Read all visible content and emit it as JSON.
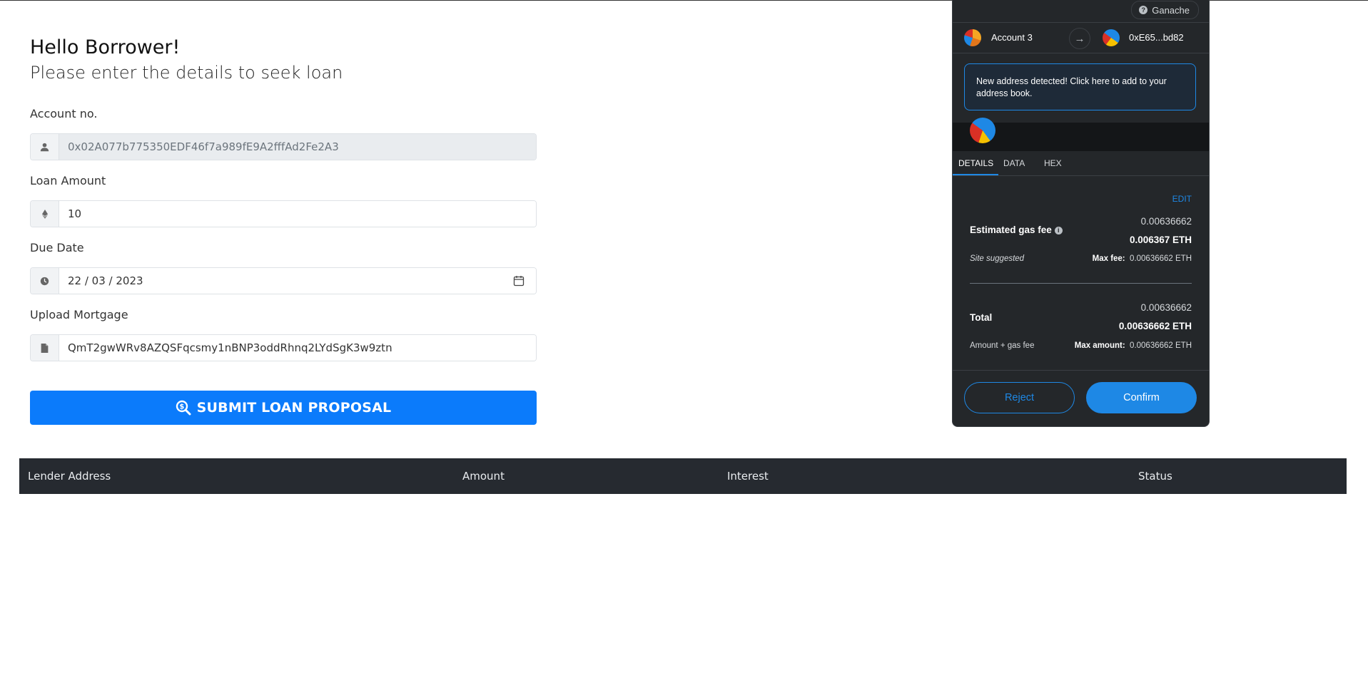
{
  "form": {
    "greeting": "Hello Borrower!",
    "subtitle": "Please enter the details to seek loan",
    "account_label": "Account no.",
    "account_value": "0x02A077b775350EDF46f7a989fE9A2fffAd2Fe2A3",
    "amount_label": "Loan Amount",
    "amount_value": "10",
    "due_label": "Due Date",
    "due_value": "22 / 03 / 2023",
    "mortgage_label": "Upload Mortgage",
    "mortgage_value": "QmT2gwWRv8AZQSFqcsmy1nBNP3oddRhnq2LYdSgK3w9ztn",
    "submit_label": "SUBMIT LOAN PROPOSAL"
  },
  "table": {
    "headers": [
      "Lender Address",
      "Amount",
      "Interest",
      "Status"
    ]
  },
  "metamask": {
    "network": "Ganache",
    "from_account": "Account 3",
    "to_address": "0xE65...bd82",
    "alert": "New address detected! Click here to add to your address book.",
    "tabs": [
      "DETAILS",
      "DATA",
      "HEX"
    ],
    "active_tab": "DETAILS",
    "edit": "EDIT",
    "gas": {
      "label": "Estimated gas fee",
      "value": "0.00636662",
      "value_eth": "0.006367 ETH",
      "note": "Site suggested",
      "max_label": "Max fee:",
      "max_value": "0.00636662 ETH"
    },
    "total": {
      "label": "Total",
      "value": "0.00636662",
      "value_eth": "0.00636662 ETH",
      "note": "Amount + gas fee",
      "max_label": "Max amount:",
      "max_value": "0.00636662 ETH"
    },
    "reject": "Reject",
    "confirm": "Confirm"
  },
  "icons": {
    "account": "user-icon",
    "amount": "ethereum-icon",
    "due": "clock-icon",
    "mortgage": "file-icon",
    "submit": "search-dollar-icon",
    "calendar": "calendar-icon"
  },
  "colors": {
    "primary": "#0b7bfb",
    "table_header": "#262a30",
    "metamask_bg": "#24272a",
    "metamask_blue": "#1e88e5"
  }
}
